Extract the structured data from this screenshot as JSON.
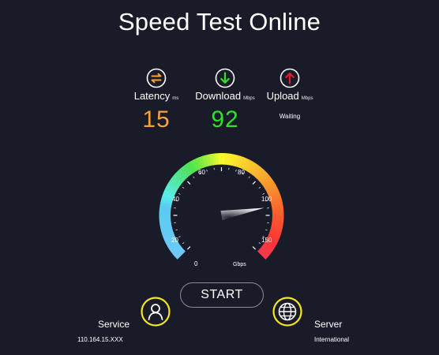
{
  "title": "Speed Test Online",
  "metrics": {
    "latency": {
      "label": "Latency",
      "unit": "ms",
      "value": "15"
    },
    "download": {
      "label": "Download",
      "unit": "Mbps",
      "value": "92"
    },
    "upload": {
      "label": "Upload",
      "unit": "Mbps",
      "status": "Waiting"
    }
  },
  "gauge": {
    "ticks": [
      "0",
      "20",
      "40",
      "60",
      "80",
      "100",
      "150"
    ],
    "unit": "Gbps",
    "needle_value": 100
  },
  "start_button": {
    "label": "START"
  },
  "service": {
    "label": "Service",
    "value": "110.164.15.XXX"
  },
  "server": {
    "label": "Server",
    "value": "International"
  },
  "colors": {
    "background": "#1a1b28",
    "latency": "#f6a23a",
    "download": "#2fe02a",
    "upload": "#e11b22",
    "accent_yellow": "#f5e71c"
  },
  "icons": {
    "latency": "swap-arrows-icon",
    "download": "download-arrow-icon",
    "upload": "upload-arrow-icon",
    "service": "user-icon",
    "server": "globe-icon"
  }
}
